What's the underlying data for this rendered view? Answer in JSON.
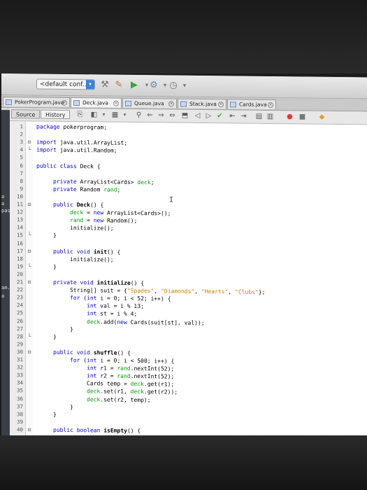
{
  "toolbar": {
    "config_label": "<default conf...",
    "config_arrow": "◆",
    "icons": [
      "hammer-icon",
      "clean-build-icon",
      "run-icon",
      "debug-icon",
      "profile-icon"
    ]
  },
  "tabs": [
    {
      "label": "PokerProgram.java",
      "active": false
    },
    {
      "label": "Deck.java",
      "active": true
    },
    {
      "label": "Queue.java",
      "active": false
    },
    {
      "label": "Stack.java",
      "active": false
    },
    {
      "label": "Cards.java",
      "active": false
    }
  ],
  "editor_bar": {
    "source_label": "Source",
    "history_label": "History"
  },
  "left_strip": {
    "labels": [
      "a",
      "a",
      "pas",
      "am.j",
      "a"
    ]
  },
  "code": [
    {
      "n": "1",
      "indent": 0,
      "fold": "",
      "parts": [
        {
          "t": "package pokerprogram;",
          "c": "kw-first"
        }
      ]
    },
    {
      "n": "2",
      "indent": 0,
      "fold": "",
      "parts": []
    },
    {
      "n": "3",
      "indent": 0,
      "fold": "⊟",
      "parts": [
        {
          "t": "import",
          "c": "kw"
        },
        {
          "t": " java.util.ArrayList;",
          "c": ""
        }
      ]
    },
    {
      "n": "4",
      "indent": 0,
      "fold": "└",
      "parts": [
        {
          "t": "import",
          "c": "kw"
        },
        {
          "t": " java.util.Random;",
          "c": ""
        }
      ]
    },
    {
      "n": "5",
      "indent": 0,
      "fold": "",
      "parts": []
    },
    {
      "n": "6",
      "indent": 0,
      "fold": "",
      "parts": [
        {
          "t": "public class",
          "c": "kw"
        },
        {
          "t": " Deck {",
          "c": ""
        }
      ]
    },
    {
      "n": "7",
      "indent": 0,
      "fold": "",
      "parts": []
    },
    {
      "n": "8",
      "indent": 2,
      "fold": "",
      "parts": [
        {
          "t": "private",
          "c": "kw"
        },
        {
          "t": " ArrayList<Cards> ",
          "c": ""
        },
        {
          "t": "deck",
          "c": "fld"
        },
        {
          "t": ";",
          "c": ""
        }
      ]
    },
    {
      "n": "9",
      "indent": 2,
      "fold": "",
      "parts": [
        {
          "t": "private",
          "c": "kw"
        },
        {
          "t": " Random ",
          "c": ""
        },
        {
          "t": "rand",
          "c": "fld"
        },
        {
          "t": ";",
          "c": ""
        }
      ]
    },
    {
      "n": "10",
      "indent": 0,
      "fold": "",
      "parts": []
    },
    {
      "n": "11",
      "indent": 2,
      "fold": "⊟",
      "parts": [
        {
          "t": "public",
          "c": "kw"
        },
        {
          "t": " ",
          "c": ""
        },
        {
          "t": "Deck",
          "c": "mth"
        },
        {
          "t": "() {",
          "c": ""
        }
      ]
    },
    {
      "n": "12",
      "indent": 4,
      "fold": "",
      "parts": [
        {
          "t": "deck",
          "c": "fld"
        },
        {
          "t": " = ",
          "c": ""
        },
        {
          "t": "new",
          "c": "kw"
        },
        {
          "t": " ArrayList<Cards>();",
          "c": ""
        }
      ]
    },
    {
      "n": "13",
      "indent": 4,
      "fold": "",
      "parts": [
        {
          "t": "rand",
          "c": "fld"
        },
        {
          "t": " = ",
          "c": ""
        },
        {
          "t": "new",
          "c": "kw"
        },
        {
          "t": " Random();",
          "c": ""
        }
      ]
    },
    {
      "n": "14",
      "indent": 4,
      "fold": "",
      "parts": [
        {
          "t": "initialize();",
          "c": ""
        }
      ]
    },
    {
      "n": "15",
      "indent": 2,
      "fold": "└",
      "parts": [
        {
          "t": "}",
          "c": ""
        }
      ]
    },
    {
      "n": "16",
      "indent": 0,
      "fold": "",
      "parts": []
    },
    {
      "n": "17",
      "indent": 2,
      "fold": "⊟",
      "parts": [
        {
          "t": "public void",
          "c": "kw"
        },
        {
          "t": " ",
          "c": ""
        },
        {
          "t": "init",
          "c": "mth"
        },
        {
          "t": "() {",
          "c": ""
        }
      ]
    },
    {
      "n": "18",
      "indent": 4,
      "fold": "",
      "parts": [
        {
          "t": "initialize();",
          "c": ""
        }
      ]
    },
    {
      "n": "19",
      "indent": 2,
      "fold": "└",
      "parts": [
        {
          "t": "}",
          "c": ""
        }
      ]
    },
    {
      "n": "20",
      "indent": 0,
      "fold": "",
      "parts": []
    },
    {
      "n": "21",
      "indent": 2,
      "fold": "⊟",
      "parts": [
        {
          "t": "private void",
          "c": "kw"
        },
        {
          "t": " ",
          "c": ""
        },
        {
          "t": "initialize",
          "c": "mth"
        },
        {
          "t": "() {",
          "c": ""
        }
      ]
    },
    {
      "n": "22",
      "indent": 4,
      "fold": "",
      "parts": [
        {
          "t": "String[] suit = {",
          "c": ""
        },
        {
          "t": "\"Spades\"",
          "c": "str"
        },
        {
          "t": ", ",
          "c": ""
        },
        {
          "t": "\"Diamonds\"",
          "c": "str"
        },
        {
          "t": ", ",
          "c": ""
        },
        {
          "t": "\"Hearts\"",
          "c": "str"
        },
        {
          "t": ", ",
          "c": ""
        },
        {
          "t": "\"Clubs\"",
          "c": "str"
        },
        {
          "t": "};",
          "c": ""
        }
      ]
    },
    {
      "n": "23",
      "indent": 4,
      "fold": "",
      "parts": [
        {
          "t": "for",
          "c": "kw"
        },
        {
          "t": " (",
          "c": ""
        },
        {
          "t": "int",
          "c": "kw"
        },
        {
          "t": " i = 0; i < 52; i++) {",
          "c": ""
        }
      ]
    },
    {
      "n": "24",
      "indent": 6,
      "fold": "",
      "parts": [
        {
          "t": "int",
          "c": "kw"
        },
        {
          "t": " val = i % 13;",
          "c": ""
        }
      ]
    },
    {
      "n": "25",
      "indent": 6,
      "fold": "",
      "parts": [
        {
          "t": "int",
          "c": "kw"
        },
        {
          "t": " st = i % 4;",
          "c": ""
        }
      ]
    },
    {
      "n": "26",
      "indent": 6,
      "fold": "",
      "parts": [
        {
          "t": "deck",
          "c": "fld"
        },
        {
          "t": ".add(",
          "c": ""
        },
        {
          "t": "new",
          "c": "kw"
        },
        {
          "t": " Cards(suit[st], val));",
          "c": ""
        }
      ]
    },
    {
      "n": "27",
      "indent": 4,
      "fold": "",
      "parts": [
        {
          "t": "}",
          "c": ""
        }
      ]
    },
    {
      "n": "28",
      "indent": 2,
      "fold": "└",
      "parts": [
        {
          "t": "}",
          "c": ""
        }
      ]
    },
    {
      "n": "29",
      "indent": 0,
      "fold": "",
      "parts": []
    },
    {
      "n": "30",
      "indent": 2,
      "fold": "⊟",
      "parts": [
        {
          "t": "public void",
          "c": "kw"
        },
        {
          "t": " ",
          "c": ""
        },
        {
          "t": "shuffle",
          "c": "mth"
        },
        {
          "t": "() {",
          "c": ""
        }
      ]
    },
    {
      "n": "31",
      "indent": 4,
      "fold": "",
      "parts": [
        {
          "t": "for",
          "c": "kw"
        },
        {
          "t": " (",
          "c": ""
        },
        {
          "t": "int",
          "c": "kw"
        },
        {
          "t": " i = 0; i < 500; i++) {",
          "c": ""
        }
      ]
    },
    {
      "n": "32",
      "indent": 6,
      "fold": "",
      "parts": [
        {
          "t": "int",
          "c": "kw"
        },
        {
          "t": " r1 = ",
          "c": ""
        },
        {
          "t": "rand",
          "c": "fld"
        },
        {
          "t": ".nextInt(52);",
          "c": ""
        }
      ]
    },
    {
      "n": "33",
      "indent": 6,
      "fold": "",
      "parts": [
        {
          "t": "int",
          "c": "kw"
        },
        {
          "t": " r2 = ",
          "c": ""
        },
        {
          "t": "rand",
          "c": "fld"
        },
        {
          "t": ".nextInt(52);",
          "c": ""
        }
      ]
    },
    {
      "n": "34",
      "indent": 6,
      "fold": "",
      "parts": [
        {
          "t": "Cards temp = ",
          "c": ""
        },
        {
          "t": "deck",
          "c": "fld"
        },
        {
          "t": ".get(r1);",
          "c": ""
        }
      ]
    },
    {
      "n": "35",
      "indent": 6,
      "fold": "",
      "parts": [
        {
          "t": "deck",
          "c": "fld"
        },
        {
          "t": ".set(r1, ",
          "c": ""
        },
        {
          "t": "deck",
          "c": "fld"
        },
        {
          "t": ".get(r2));",
          "c": ""
        }
      ]
    },
    {
      "n": "36",
      "indent": 6,
      "fold": "",
      "parts": [
        {
          "t": "deck",
          "c": "fld"
        },
        {
          "t": ".set(r2, temp);",
          "c": ""
        }
      ]
    },
    {
      "n": "37",
      "indent": 4,
      "fold": "",
      "parts": [
        {
          "t": "}",
          "c": ""
        }
      ]
    },
    {
      "n": "38",
      "indent": 2,
      "fold": "",
      "parts": [
        {
          "t": "}",
          "c": ""
        }
      ]
    },
    {
      "n": "39",
      "indent": 0,
      "fold": "",
      "parts": []
    },
    {
      "n": "40",
      "indent": 2,
      "fold": "⊟",
      "parts": [
        {
          "t": "public boolean",
          "c": "kw"
        },
        {
          "t": " ",
          "c": ""
        },
        {
          "t": "isEmpty",
          "c": "mth"
        },
        {
          "t": "() {",
          "c": ""
        }
      ]
    }
  ],
  "colors": {
    "keyword": "#0000e6",
    "field": "#009900",
    "string": "#ce7b00"
  }
}
